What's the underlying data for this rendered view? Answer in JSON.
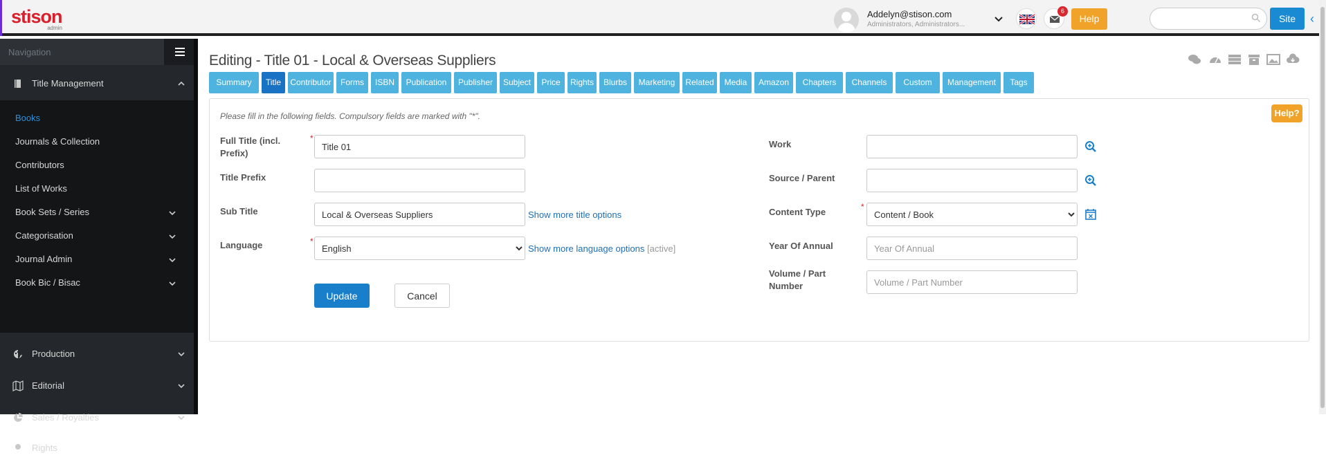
{
  "header": {
    "logo": "stison",
    "logo_sub": "admin",
    "user_email": "Addelyn@stison.com",
    "user_roles": "Administrators, Administrators...",
    "mail_count": "6",
    "help_label": "Help",
    "search_placeholder": "",
    "site_label": "Site"
  },
  "sidebar": {
    "nav_label": "Navigation",
    "sections": [
      {
        "label": "Title Management",
        "icon": "book-icon",
        "expanded": true
      },
      {
        "label": "Production",
        "icon": "palette-icon"
      },
      {
        "label": "Editorial",
        "icon": "map-icon"
      },
      {
        "label": "Sales / Royalties",
        "icon": "pie-chart-icon"
      },
      {
        "label": "Rights",
        "icon": "pin-icon"
      }
    ],
    "sub_items": [
      {
        "label": "Books",
        "active": true
      },
      {
        "label": "Journals & Collection"
      },
      {
        "label": "Contributors"
      },
      {
        "label": "List of Works"
      },
      {
        "label": "Book Sets / Series",
        "has_children": true
      },
      {
        "label": "Categorisation",
        "has_children": true
      },
      {
        "label": "Journal Admin",
        "has_children": true
      },
      {
        "label": "Book Bic / Bisac",
        "has_children": true
      }
    ]
  },
  "main": {
    "title": "Editing - Title 01 - Local & Overseas Suppliers",
    "tabs": [
      "Summary",
      "Title",
      "Contributor",
      "Forms",
      "ISBN",
      "Publication",
      "Publisher",
      "Subject",
      "Price",
      "Rights",
      "Blurbs",
      "Marketing",
      "Related",
      "Media",
      "Amazon",
      "Chapters",
      "Channels",
      "Custom",
      "Management",
      "Tags"
    ],
    "active_tab": "Title",
    "help_label": "Help?",
    "instructions": "Please fill in the following fields. Compulsory fields are marked with \"*\".",
    "left_fields": {
      "full_title_label": "Full Title (incl. Prefix)",
      "full_title_value": "Title 01",
      "title_prefix_label": "Title Prefix",
      "title_prefix_value": "",
      "sub_title_label": "Sub Title",
      "sub_title_value": "Local & Overseas Suppliers",
      "show_more_title": "Show more title options",
      "language_label": "Language",
      "language_value": "English",
      "show_more_language": "Show more language options",
      "active_note": "[active]"
    },
    "right_fields": {
      "work_label": "Work",
      "work_value": "",
      "source_label": "Source / Parent",
      "source_value": "",
      "content_type_label": "Content Type",
      "content_type_value": "Content / Book",
      "year_label": "Year Of Annual",
      "year_placeholder": "Year Of Annual",
      "volume_label": "Volume / Part Number",
      "volume_placeholder": "Volume / Part Number"
    },
    "update_label": "Update",
    "cancel_label": "Cancel"
  },
  "colors": {
    "brand_red": "#d6202c",
    "tab_blue": "#4fb3df",
    "tab_active": "#1a72c4",
    "accent_orange": "#f0a229",
    "sidebar_bg": "#24272b"
  }
}
